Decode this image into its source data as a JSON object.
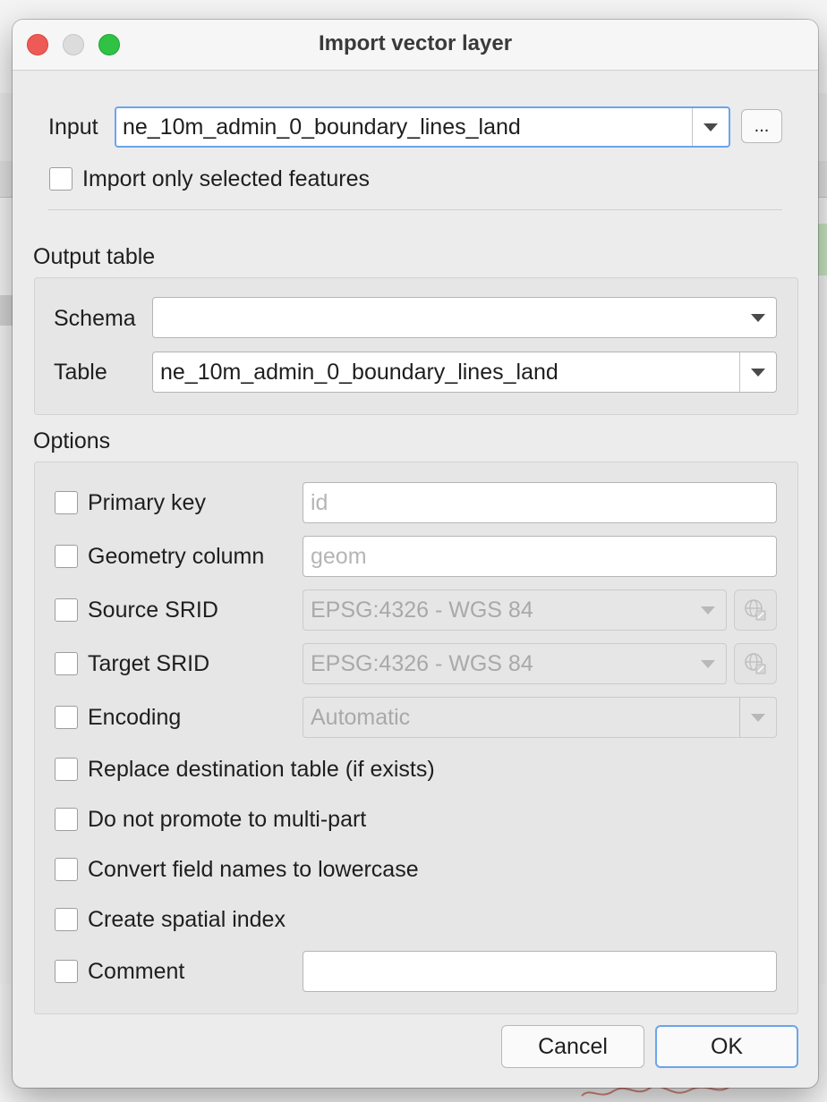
{
  "dialog": {
    "title": "Import vector layer"
  },
  "input_section": {
    "input_label": "Input",
    "input_value": "ne_10m_admin_0_boundary_lines_land",
    "browse_label": "...",
    "selected_only_label": "Import only selected features"
  },
  "output_table": {
    "heading": "Output table",
    "schema_label": "Schema",
    "schema_value": "",
    "table_label": "Table",
    "table_value": "ne_10m_admin_0_boundary_lines_land"
  },
  "options": {
    "heading": "Options",
    "primary_key_label": "Primary key",
    "primary_key_placeholder": "id",
    "geometry_column_label": "Geometry column",
    "geometry_column_placeholder": "geom",
    "source_srid_label": "Source SRID",
    "source_srid_value": "EPSG:4326 - WGS 84",
    "target_srid_label": "Target SRID",
    "target_srid_value": "EPSG:4326 - WGS 84",
    "encoding_label": "Encoding",
    "encoding_value": "Automatic",
    "replace_table_label": "Replace destination table (if exists)",
    "no_multipart_label": "Do not promote to multi-part",
    "lowercase_label": "Convert field names to lowercase",
    "spatial_index_label": "Create spatial index",
    "comment_label": "Comment",
    "comment_value": ""
  },
  "buttons": {
    "cancel": "Cancel",
    "ok": "OK"
  },
  "colors": {
    "focus_ring": "#6aa5ec",
    "close": "#ee5b57",
    "minimize": "#dcdcdc",
    "maximize": "#2fc244",
    "dialog_bg": "#ececec"
  },
  "icons": {
    "crs_selector": "globe-select-icon",
    "dropdown": "chevron-down-icon"
  }
}
